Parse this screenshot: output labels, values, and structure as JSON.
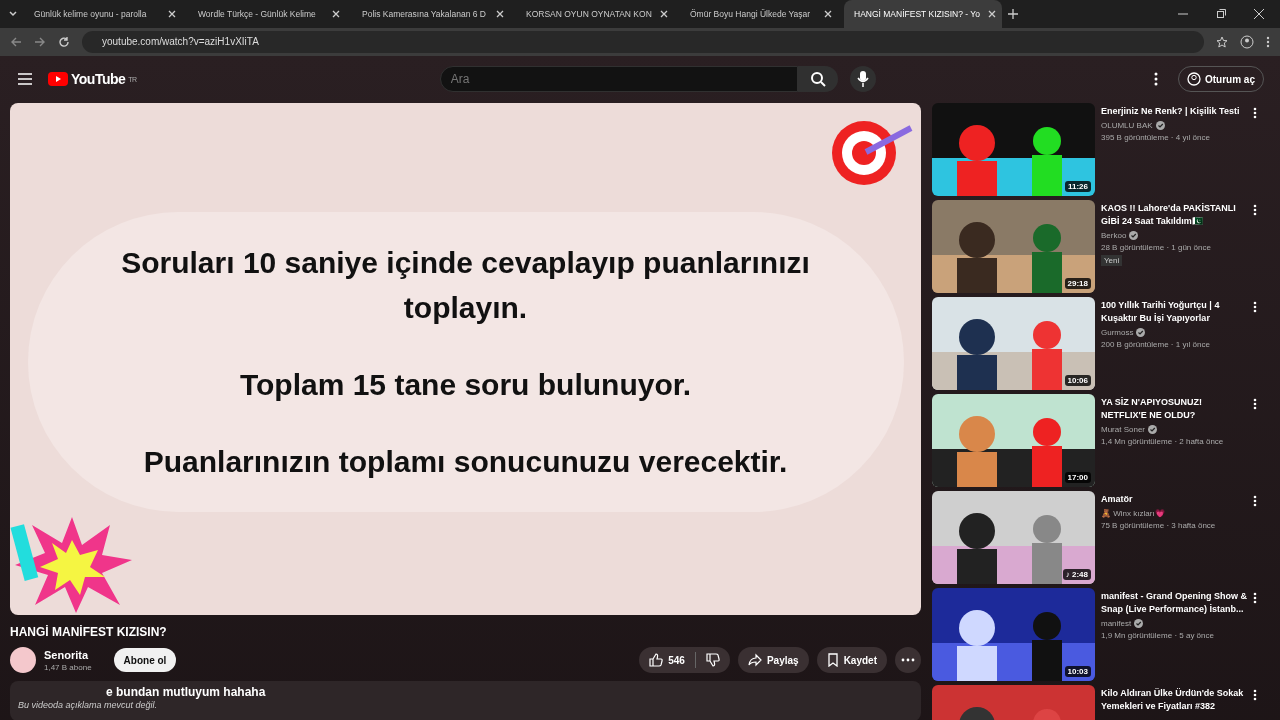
{
  "tabs": [
    {
      "title": "Günlük kelime oyunu - parolla",
      "selected": false
    },
    {
      "title": "Wordle Türkçe - Günlük Kelime",
      "selected": false
    },
    {
      "title": "Polis Kamerasına Yakalanan 6 D",
      "selected": false
    },
    {
      "title": "KORSAN OYUN OYNATAN KON",
      "selected": false
    },
    {
      "title": "Ömür Boyu Hangi Ülkede Yaşar",
      "selected": false
    },
    {
      "title": "HANGİ MANİFEST KIZISIN? - Yo",
      "selected": true
    }
  ],
  "address": "youtube.com/watch?v=aziH1vXIiTA",
  "header": {
    "logo": "YouTube",
    "region": "TR",
    "search": {
      "placeholder": "Ara"
    },
    "sign_in": "Oturum aç"
  },
  "video": {
    "lines": [
      "Soruları 10 saniye içinde cevaplayıp puanlarınızı toplayın.",
      "Toplam 15 tane soru bulunuyor.",
      "Puanlarınızın toplamı sonucunuzu verecektir."
    ]
  },
  "title": "HANGİ MANİFEST KIZISIN?",
  "channel": {
    "name": "Senorita",
    "subscribers": "1,47 B abone",
    "subscribe": "Abone ol"
  },
  "actions": {
    "likes": "546",
    "share": "Paylaş",
    "save": "Kaydet"
  },
  "description": {
    "overlay": "e bundan mutluyum hahaha",
    "text": "Bu videoda açıklama mevcut değil."
  },
  "related": [
    {
      "title": "Enerjiniz Ne Renk? | Kişilik Testi",
      "channel": "OLUMLU BAK",
      "verified": true,
      "meta": "395 B görüntüleme · 4 yıl önce",
      "duration": "11:26"
    },
    {
      "title": "KAOS !! Lahore'da PAKİSTANLI GİBİ 24 Saat Takıldım🇵🇰",
      "channel": "Berkoo",
      "verified": true,
      "meta": "28 B görüntüleme · 1 gün önce",
      "duration": "29:18",
      "badge": "Yeni"
    },
    {
      "title": "100 Yıllık Tarihi Yoğurtçu | 4 Kuşaktır Bu İşi Yapıyorlar",
      "channel": "Gurmoss",
      "verified": true,
      "meta": "200 B görüntüleme · 1 yıl önce",
      "duration": "10:06"
    },
    {
      "title": "YA SİZ N'APIYOSUNUZ! NETFLIX'E NE OLDU?",
      "channel": "Murat Soner",
      "verified": true,
      "meta": "1,4 Mn görüntüleme · 2 hafta önce",
      "duration": "17:00"
    },
    {
      "title": "Amatör",
      "channel": "🧸 Winx kızları💗",
      "verified": false,
      "meta": "75 B görüntüleme · 3 hafta önce",
      "duration": "♪ 2:48"
    },
    {
      "title": "manifest - Grand Opening Show & Snap (Live Performance) İstanb...",
      "channel": "manifest",
      "verified": true,
      "meta": "1,9 Mn görüntüleme · 5 ay önce",
      "duration": "10:03"
    },
    {
      "title": "Kilo Aldıran Ülke Ürdün'de Sokak Yemekleri ve Fiyatları #382"
    }
  ]
}
